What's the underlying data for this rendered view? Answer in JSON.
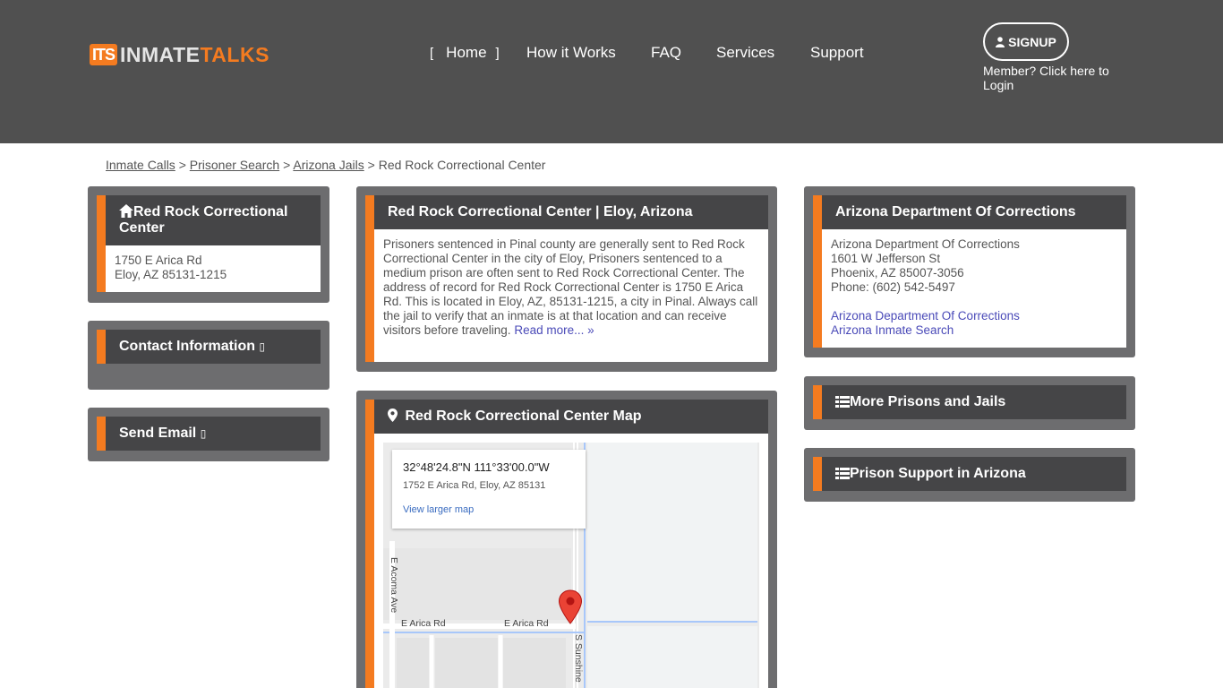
{
  "header": {
    "logo_badge": "ITS",
    "logo_part1": "INMATE",
    "logo_part2": "TALKS",
    "nav": {
      "bracket_left": "[",
      "home": "Home",
      "bracket_right": "]",
      "how_it_works": "How it Works",
      "faq": "FAQ",
      "services": "Services",
      "support": "Support"
    },
    "signup_label": "SIGNUP",
    "login_text": "Member? Click here to Login"
  },
  "breadcrumb": {
    "items": [
      "Inmate Calls",
      "Prisoner Search",
      "Arizona Jails"
    ],
    "separator": ">",
    "current": "Red Rock Correctional Center"
  },
  "facility_card": {
    "title": "Red Rock Correctional Center",
    "address_line1": "1750 E Arica Rd",
    "address_line2": "Eloy, AZ 85131-1215"
  },
  "contact_panel": {
    "title": "Contact Information",
    "glyph": "▯"
  },
  "email_panel": {
    "title": "Send Email",
    "glyph": "▯"
  },
  "description_panel": {
    "title": "Red Rock Correctional Center | Eloy, Arizona",
    "body": "Prisoners sentenced in Pinal county are generally sent to Red Rock Correctional Center in the city of Eloy, Prisoners sentenced to a medium prison are often sent to Red Rock Correctional Center. The address of record for Red Rock Correctional Center is 1750 E Arica Rd. This is located in Eloy, AZ, 85131-1215, a city in Pinal. Always call the jail to verify that an inmate is at that location and can receive visitors before traveling.",
    "read_more": "Read more... »"
  },
  "map_panel": {
    "title": "Red Rock Correctional Center Map",
    "coords": "32°48'24.8\"N 111°33'00.0\"W",
    "address": "1752 E Arica Rd, Eloy, AZ 85131",
    "view_larger": "View larger map",
    "road_labels": {
      "acoma": "E Acoma Ave",
      "arica1": "E Arica Rd",
      "arica2": "E Arica Rd",
      "sunshine": "S Sunshine"
    }
  },
  "doc_panel": {
    "title": "Arizona Department Of Corrections",
    "name": "Arizona Department Of Corrections",
    "street": "1601 W Jefferson St",
    "city": "Phoenix, AZ 85007-3056",
    "phone": "Phone: (602) 542-5497",
    "link1": "Arizona Department Of Corrections",
    "link2": "Arizona Inmate Search"
  },
  "more_prisons_panel": {
    "title": "More Prisons and Jails"
  },
  "prison_support_panel": {
    "title": "Prison Support in Arizona"
  },
  "colors": {
    "header_bg": "#505050",
    "accent": "#f47b20",
    "panel_bg": "#6d6d6f",
    "panel_head": "#454547",
    "link": "#4a4ab8"
  }
}
